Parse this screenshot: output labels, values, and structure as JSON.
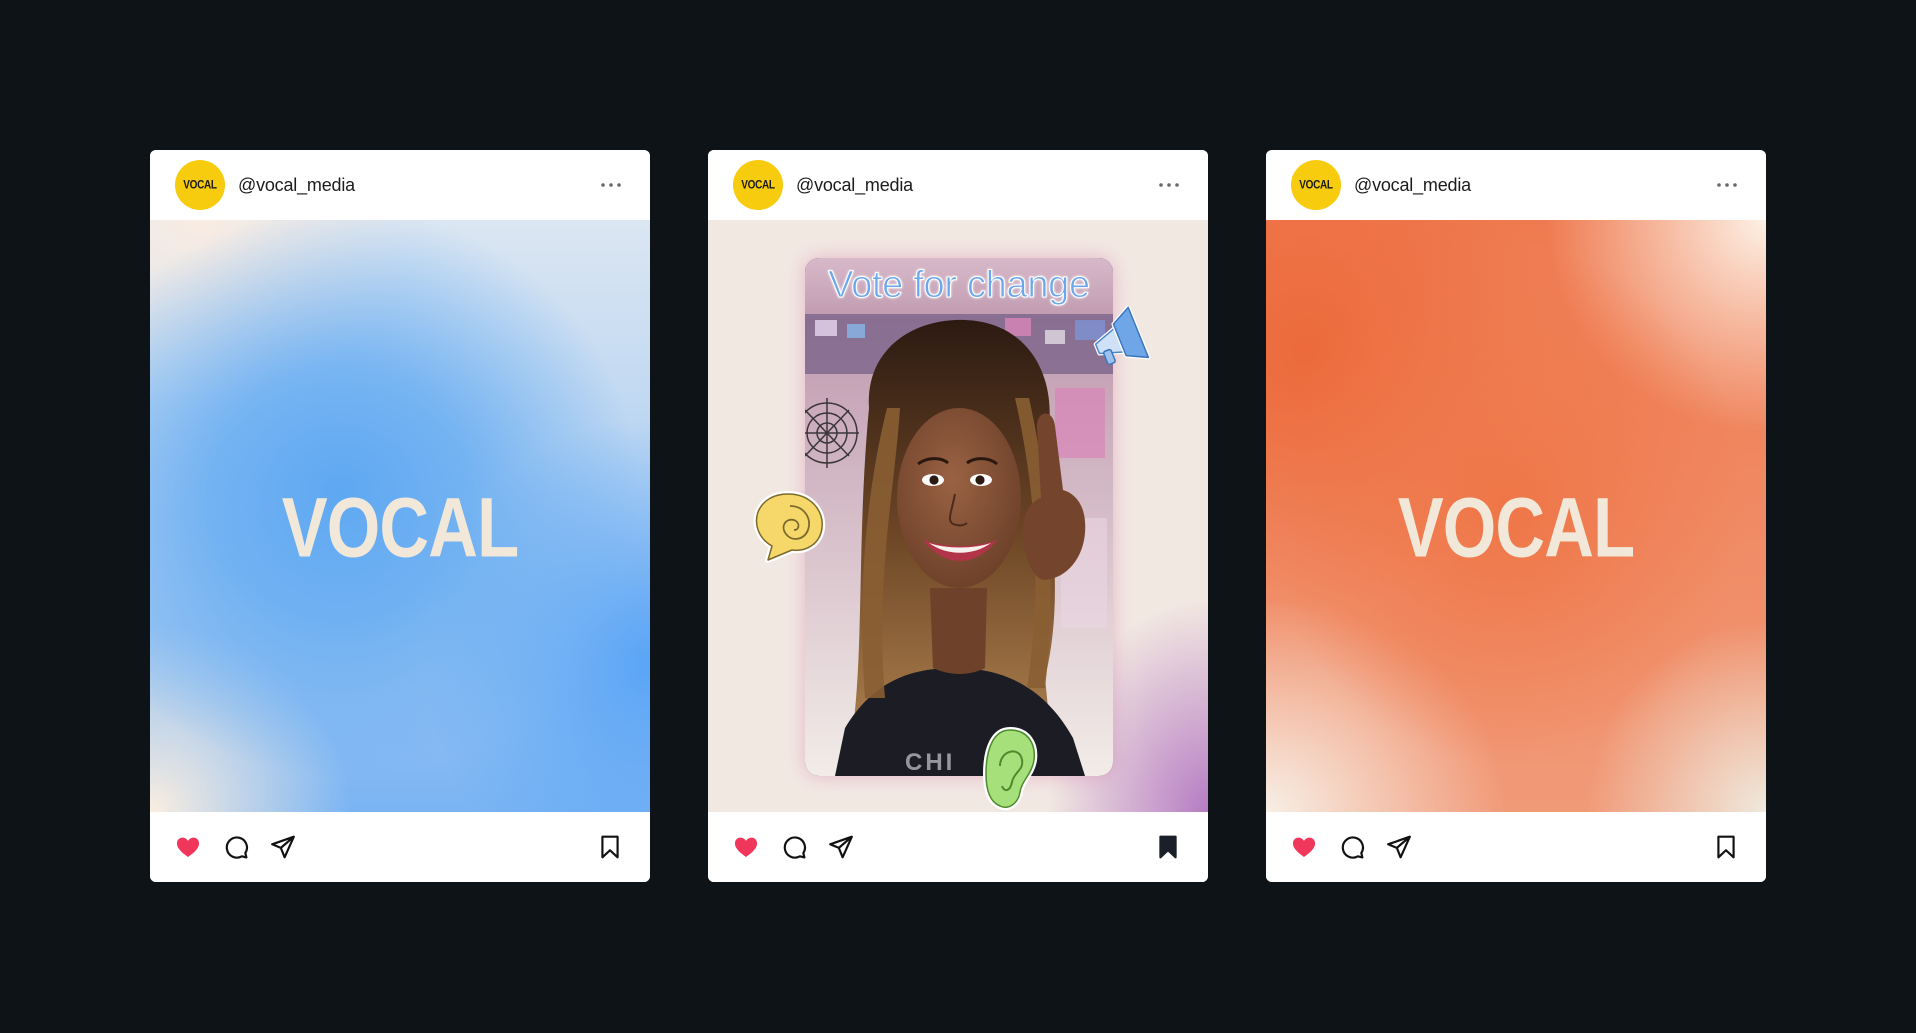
{
  "posts": [
    {
      "username": "@vocal_media",
      "avatar_text": "VOCAL",
      "media_type": "gradient",
      "media_wordmark": "VOCAL",
      "liked": true,
      "saved": false
    },
    {
      "username": "@vocal_media",
      "avatar_text": "VOCAL",
      "media_type": "video",
      "video_caption": "Vote for change",
      "liked": true,
      "saved": true
    },
    {
      "username": "@vocal_media",
      "avatar_text": "VOCAL",
      "media_type": "gradient",
      "media_wordmark": "VOCAL",
      "liked": true,
      "saved": false
    }
  ],
  "icons": {
    "like": "heart-icon",
    "comment": "comment-bubble-icon",
    "share": "paper-plane-icon",
    "save": "bookmark-icon",
    "more": "more-dots-icon"
  },
  "colors": {
    "page_background": "#0e1318",
    "avatar_yellow": "#f7cb0e",
    "like_red": "#f0365a",
    "wordmark_cream": "#f2e8d9",
    "caption_blue": "#6ba7ea"
  }
}
